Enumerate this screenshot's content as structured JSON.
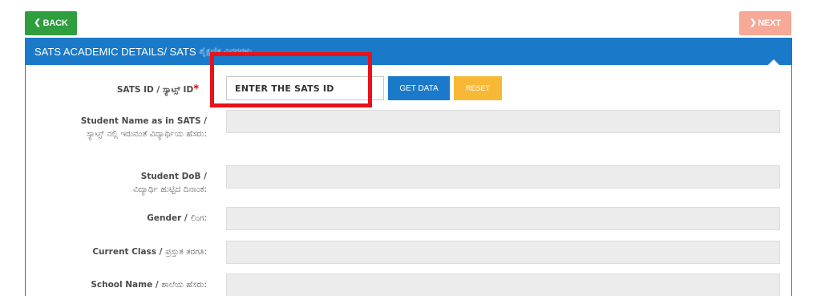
{
  "nav": {
    "back_label": "BACK",
    "next_label": "NEXT"
  },
  "panel": {
    "title": "SATS ACADEMIC DETAILS/ SATS",
    "title_local": "ಶೈಕ್ಷಣಿಕ ವಿವರಗಳು"
  },
  "form": {
    "sats_id": {
      "label": "SATS ID / ಸ್ಯಾಟ್ಸ್ ID",
      "required_mark": "*",
      "value": "",
      "placeholder": "ENTER THE SATS ID",
      "get_data_label": "GET DATA",
      "reset_label": "RESET"
    },
    "student_name": {
      "label_en": "Student Name as in SATS /",
      "label_local": "ಸ್ಯಾಟ್ಸ್ ನಲ್ಲಿ ಇರುವಂತೆ ವಿದ್ಯಾರ್ಥಿಯ ಹೆಸರು:",
      "value": ""
    },
    "student_dob": {
      "label_en": "Student DoB /",
      "label_local": "ವಿದ್ಯಾರ್ಥಿ ಹುಟ್ಟಿದ ದಿನಾಂಕ:",
      "value": ""
    },
    "gender": {
      "label_en": "Gender /",
      "label_local": "ಲಿಂಗ:",
      "value": ""
    },
    "current_class": {
      "label_en": "Current Class /",
      "label_local": "ಪ್ರಸ್ತುತ ತರಗತಿ:",
      "value": ""
    },
    "school_name": {
      "label_en": "School Name /",
      "label_local": "ಶಾಲೆಯ ಹೆಸರು:",
      "value": ""
    }
  },
  "colors": {
    "back_button": "#2e9e3e",
    "next_button": "#f5a996",
    "panel_header": "#1a7ac9",
    "get_data_button": "#1a7ac9",
    "reset_button": "#f7b835",
    "highlight": "#e8121a"
  },
  "icons": {
    "back": "chevron-left-icon",
    "next": "chevron-right-icon"
  }
}
